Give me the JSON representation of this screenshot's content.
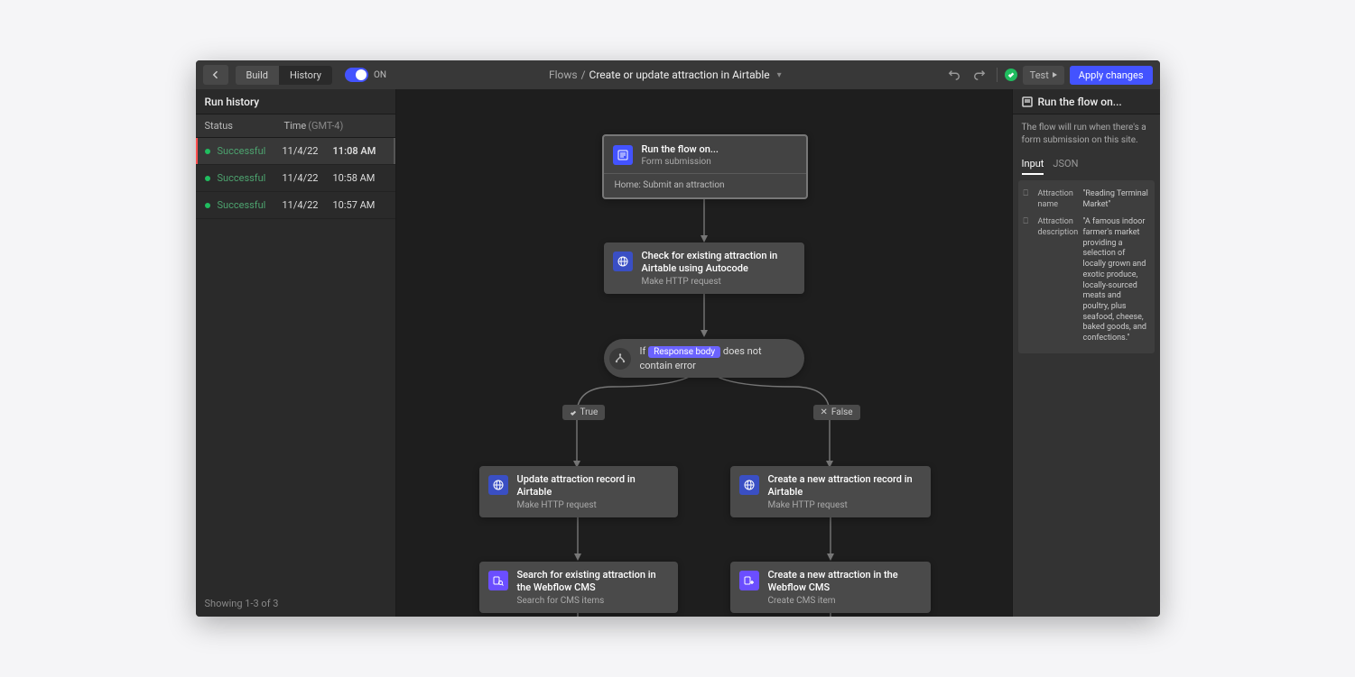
{
  "topbar": {
    "tabs": {
      "build": "Build",
      "history": "History"
    },
    "toggle_label": "ON",
    "breadcrumb_root": "Flows",
    "breadcrumb_sep": "/",
    "breadcrumb_current": "Create or update attraction in Airtable",
    "test_label": "Test",
    "apply_label": "Apply changes"
  },
  "left": {
    "header": "Run history",
    "col_status": "Status",
    "col_time": "Time",
    "col_tz": "(GMT-4)",
    "rows": [
      {
        "status": "Successful",
        "date": "11/4/22",
        "time": "11:08 AM"
      },
      {
        "status": "Successful",
        "date": "11/4/22",
        "time": "10:58 AM"
      },
      {
        "status": "Successful",
        "date": "11/4/22",
        "time": "10:57 AM"
      }
    ],
    "footer": "Showing 1-3 of 3"
  },
  "canvas": {
    "trigger": {
      "title": "Run the flow on...",
      "sub": "Form submission",
      "meta": "Home: Submit an attraction"
    },
    "check": {
      "title": "Check for existing attraction in Airtable using Autocode",
      "sub": "Make HTTP request"
    },
    "cond": {
      "prefix": "If",
      "chip": "Response body",
      "suffix": "does not contain error"
    },
    "true_label": "True",
    "false_label": "False",
    "update": {
      "title": "Update attraction record in Airtable",
      "sub": "Make HTTP request"
    },
    "create_at": {
      "title": "Create a new attraction record in Airtable",
      "sub": "Make HTTP request"
    },
    "search_cms": {
      "title": "Search for existing attraction in the Webflow CMS",
      "sub": "Search for CMS items"
    },
    "create_cms": {
      "title": "Create a new attraction in the Webflow CMS",
      "sub": "Create CMS item"
    }
  },
  "right": {
    "header": "Run the flow on...",
    "desc": "The flow will run when there's a form submission on this site.",
    "tab_input": "Input",
    "tab_json": "JSON",
    "inputs": [
      {
        "label": "Attraction name",
        "value": "\"Reading Terminal Market\""
      },
      {
        "label": "Attraction description",
        "value": "\"A famous indoor farmer's market providing a selection of locally grown and exotic produce, locally-sourced meats and poultry, plus seafood, cheese, baked goods, and confections.\""
      }
    ]
  }
}
